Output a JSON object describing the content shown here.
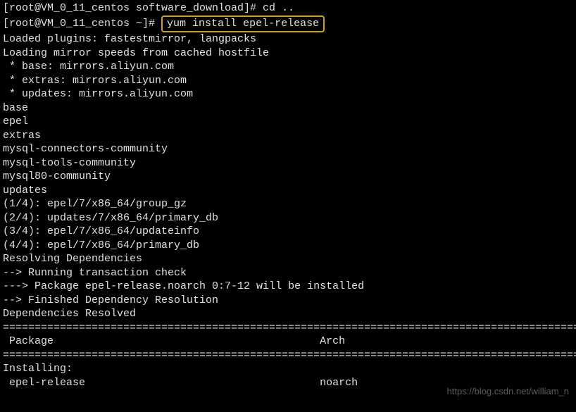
{
  "partial_top": "[root@VM_0_11_centos software_download]# cd ..",
  "prompt": "[root@VM_0_11_centos ~]# ",
  "command": "yum install epel-release",
  "lines": [
    "Loaded plugins: fastestmirror, langpacks",
    "Loading mirror speeds from cached hostfile",
    " * base: mirrors.aliyun.com",
    " * extras: mirrors.aliyun.com",
    " * updates: mirrors.aliyun.com",
    "base",
    "epel",
    "extras",
    "mysql-connectors-community",
    "mysql-tools-community",
    "mysql80-community",
    "updates",
    "(1/4): epel/7/x86_64/group_gz",
    "(2/4): updates/7/x86_64/primary_db",
    "(3/4): epel/7/x86_64/updateinfo",
    "(4/4): epel/7/x86_64/primary_db",
    "Resolving Dependencies",
    "--> Running transaction check",
    "---> Package epel-release.noarch 0:7-12 will be installed",
    "--> Finished Dependency Resolution",
    "",
    "Dependencies Resolved",
    ""
  ],
  "divider": "==============================================================================================",
  "header_package": " Package",
  "header_arch": "Arch",
  "installing_label": "Installing:",
  "install_package": " epel-release",
  "install_arch": "noarch",
  "watermark": "https://blog.csdn.net/william_n"
}
